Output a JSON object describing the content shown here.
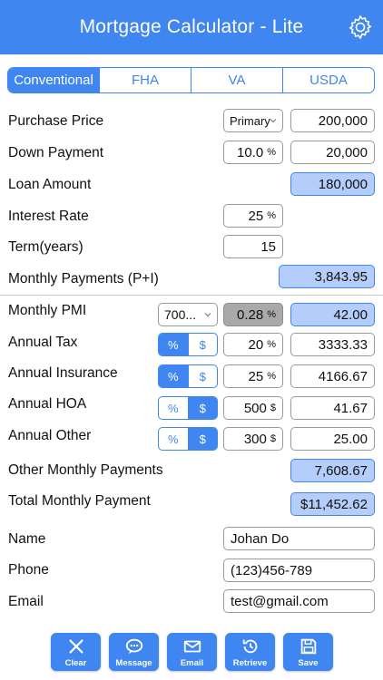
{
  "header": {
    "title": "Mortgage Calculator - Lite",
    "settings_icon": "gear-icon"
  },
  "tabs": [
    {
      "label": "Conventional",
      "active": true
    },
    {
      "label": "FHA",
      "active": false
    },
    {
      "label": "VA",
      "active": false
    },
    {
      "label": "USDA",
      "active": false
    }
  ],
  "loan": {
    "purchase_price": {
      "label": "Purchase Price",
      "property_type": "Primary",
      "value": "200,000"
    },
    "down_payment": {
      "label": "Down Payment",
      "percent": "10.0",
      "percent_unit": "%",
      "value": "20,000"
    },
    "loan_amount": {
      "label": "Loan Amount",
      "value": "180,000"
    },
    "interest_rate": {
      "label": "Interest Rate",
      "value": "25",
      "unit": "%"
    },
    "term": {
      "label": "Term(years)",
      "value": "15"
    },
    "monthly_payments": {
      "label": "Monthly Payments (P+I)",
      "value": "3,843.95"
    }
  },
  "costs": {
    "pmi": {
      "label": "Monthly PMI",
      "credit_score": "700...",
      "rate": "0.28",
      "unit": "%",
      "value": "42.00"
    },
    "tax": {
      "label": "Annual Tax",
      "mode": "%",
      "input": "20",
      "unit": "%",
      "value": "3333.33"
    },
    "insurance": {
      "label": "Annual Insurance",
      "mode": "%",
      "input": "25",
      "unit": "%",
      "value": "4166.67"
    },
    "hoa": {
      "label": "Annual HOA",
      "mode": "$",
      "input": "500",
      "unit": "$",
      "value": "41.67"
    },
    "other": {
      "label": "Annual Other",
      "mode": "$",
      "input": "300",
      "unit": "$",
      "value": "25.00"
    },
    "toggle_labels": {
      "percent": "%",
      "dollar": "$"
    }
  },
  "totals": {
    "other_monthly": {
      "label": "Other Monthly Payments",
      "value": "7,608.67"
    },
    "total_monthly": {
      "label": "Total Monthly Payment",
      "value": "$11,452.62"
    }
  },
  "contact": {
    "name": {
      "label": "Name",
      "value": "Johan Do"
    },
    "phone": {
      "label": "Phone",
      "value": "(123)456-789"
    },
    "email": {
      "label": "Email",
      "value": "test@gmail.com"
    }
  },
  "actions": [
    {
      "label": "Clear",
      "icon": "close-icon"
    },
    {
      "label": "Message",
      "icon": "message-icon"
    },
    {
      "label": "Email",
      "icon": "envelope-icon"
    },
    {
      "label": "Retrieve",
      "icon": "history-icon"
    },
    {
      "label": "Save",
      "icon": "floppy-disk-icon"
    }
  ],
  "colors": {
    "accent": "#3f86f0",
    "highlight": "#b4cdfa",
    "disabled": "#a9a9a9"
  }
}
